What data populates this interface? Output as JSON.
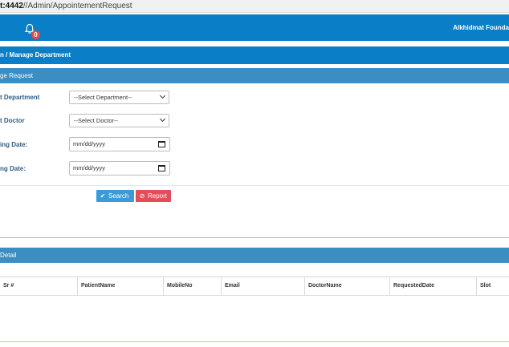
{
  "browser": {
    "url_host_fragment": "t:4442",
    "url_path": "//Admin/AppointementRequest"
  },
  "topbar": {
    "notification_count": "0",
    "org_name": "Alkhidmat Founda"
  },
  "breadcrumb": {
    "text": "n  /  Manage Department"
  },
  "form_panel": {
    "title": "ge Request",
    "department_label": "t Department",
    "department_selected": "--Select Department--",
    "doctor_label": "t Doctor",
    "doctor_selected": "--Select Doctor--",
    "from_date_label": "ing Date:",
    "from_date_value": "mm/dd/yyyy",
    "to_date_label": "ng Date:",
    "to_date_value": "mm/dd/yyyy",
    "search_label": "Search",
    "report_label": "Report"
  },
  "detail_panel": {
    "title": "Detail",
    "columns": [
      "Sr #",
      "PatientName",
      "MobileNo",
      "Email",
      "DoctorName",
      "RequestedDate",
      "Slot"
    ]
  },
  "colors": {
    "primary": "#0a7ec6",
    "panel_header": "#3a8ec4",
    "search_button": "#3d9ad8",
    "report_button": "#e34d5a",
    "badge": "#e04b4b",
    "label": "#2d5c86"
  },
  "icons": {
    "bell": "bell-icon",
    "search": "check-icon",
    "report": "ban-icon",
    "select_arrow": "chevron-down-icon",
    "date_picker": "calendar-icon"
  }
}
